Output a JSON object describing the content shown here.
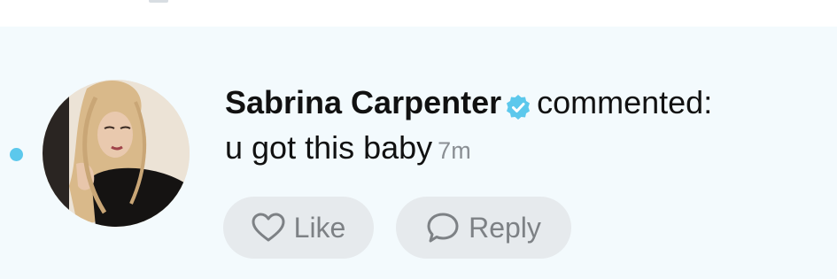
{
  "notification": {
    "author": "Sabrina Carpenter",
    "action": "commented:",
    "comment_text": "u got this baby",
    "timestamp": "7m",
    "verified_icon": "verified-badge-icon",
    "unread": true
  },
  "actions": {
    "like_label": "Like",
    "like_icon": "heart-outline-icon",
    "reply_label": "Reply",
    "reply_icon": "speech-bubble-icon"
  },
  "colors": {
    "row_background": "#f3fafd",
    "unread_dot": "#5cc8ec",
    "verified_badge": "#5cc8ec",
    "button_background": "#e6eaed",
    "timestamp": "#8a8f94",
    "button_text": "#7d8185"
  }
}
